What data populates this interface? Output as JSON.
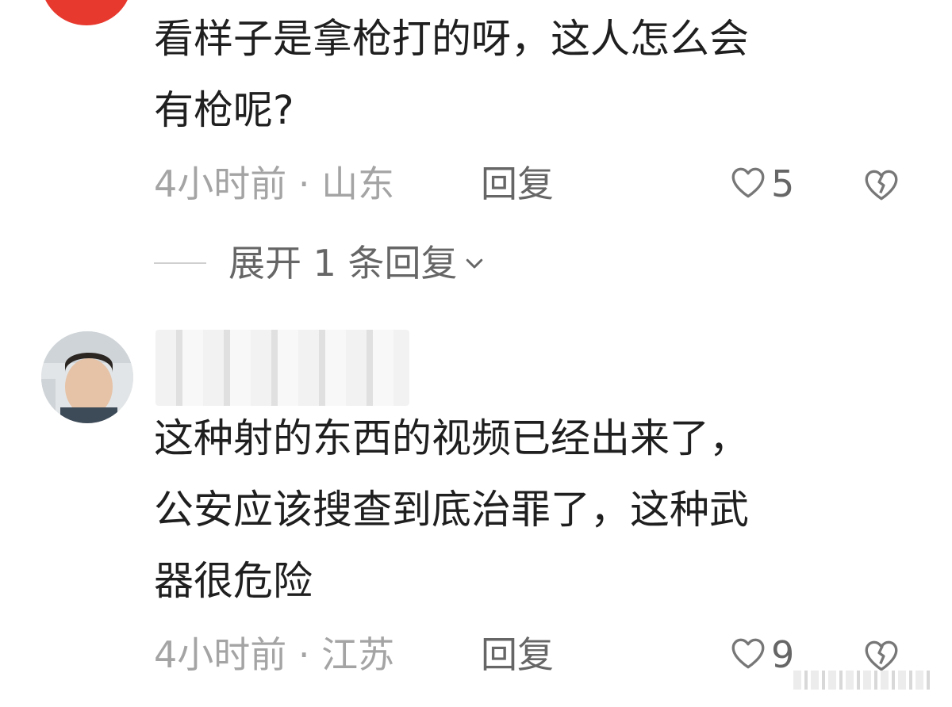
{
  "comments": [
    {
      "text": "看样子是拿枪打的呀，这人怎么会\n有枪呢?",
      "time": "4小时前",
      "location": "山东",
      "reply_label": "回复",
      "likes": "5",
      "expand_label": "展开 1 条回复"
    },
    {
      "text": "这种射的东西的视频已经出来了，\n公安应该搜查到底治罪了，这种武\n器很危险",
      "time": "4小时前",
      "location": "江苏",
      "reply_label": "回复",
      "likes": "9"
    }
  ],
  "separator": " · ",
  "icons": {
    "like": "heart-outline-icon",
    "dislike": "broken-heart-icon",
    "expand": "chevron-down-icon"
  },
  "colors": {
    "avatar_top": "#e8392f",
    "meta_text": "#a4a4a4",
    "action_text": "#666666"
  }
}
